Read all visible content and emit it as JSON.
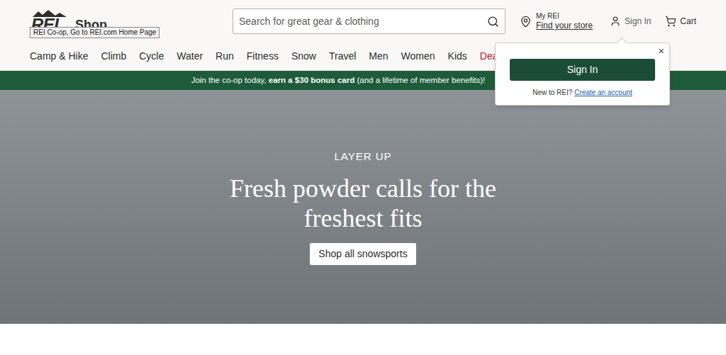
{
  "logo": {
    "brand": "REI",
    "section": "Shop",
    "tooltip": "REI Co-op, Go to REI.com Home Page"
  },
  "search": {
    "placeholder": "Search for great gear & clothing"
  },
  "store": {
    "label": "My REI",
    "link": "Find your store"
  },
  "account": {
    "label": "Sign In"
  },
  "cart": {
    "label": "Cart"
  },
  "nav": [
    {
      "label": "Camp & Hike",
      "color": "#2e2e2b"
    },
    {
      "label": "Climb",
      "color": "#2e2e2b"
    },
    {
      "label": "Cycle",
      "color": "#2e2e2b"
    },
    {
      "label": "Water",
      "color": "#2e2e2b"
    },
    {
      "label": "Run",
      "color": "#2e2e2b"
    },
    {
      "label": "Fitness",
      "color": "#2e2e2b"
    },
    {
      "label": "Snow",
      "color": "#2e2e2b"
    },
    {
      "label": "Travel",
      "color": "#2e2e2b"
    },
    {
      "label": "Men",
      "color": "#2e2e2b"
    },
    {
      "label": "Women",
      "color": "#2e2e2b"
    },
    {
      "label": "Kids",
      "color": "#2e2e2b"
    },
    {
      "label": "Dea",
      "color": "#c8102e"
    }
  ],
  "banner": {
    "before": "Join the co-op today, ",
    "bold": "earn a $30 bonus card",
    "after": " (and a lifetime of member benefits)!"
  },
  "hero": {
    "eyebrow": "LAYER UP",
    "headline": "Fresh powder calls for the freshest fits",
    "button": "Shop all snowsports"
  },
  "popup": {
    "close": "×",
    "button": "Sign In",
    "prompt": "New to REI?",
    "link": "Create an account"
  }
}
